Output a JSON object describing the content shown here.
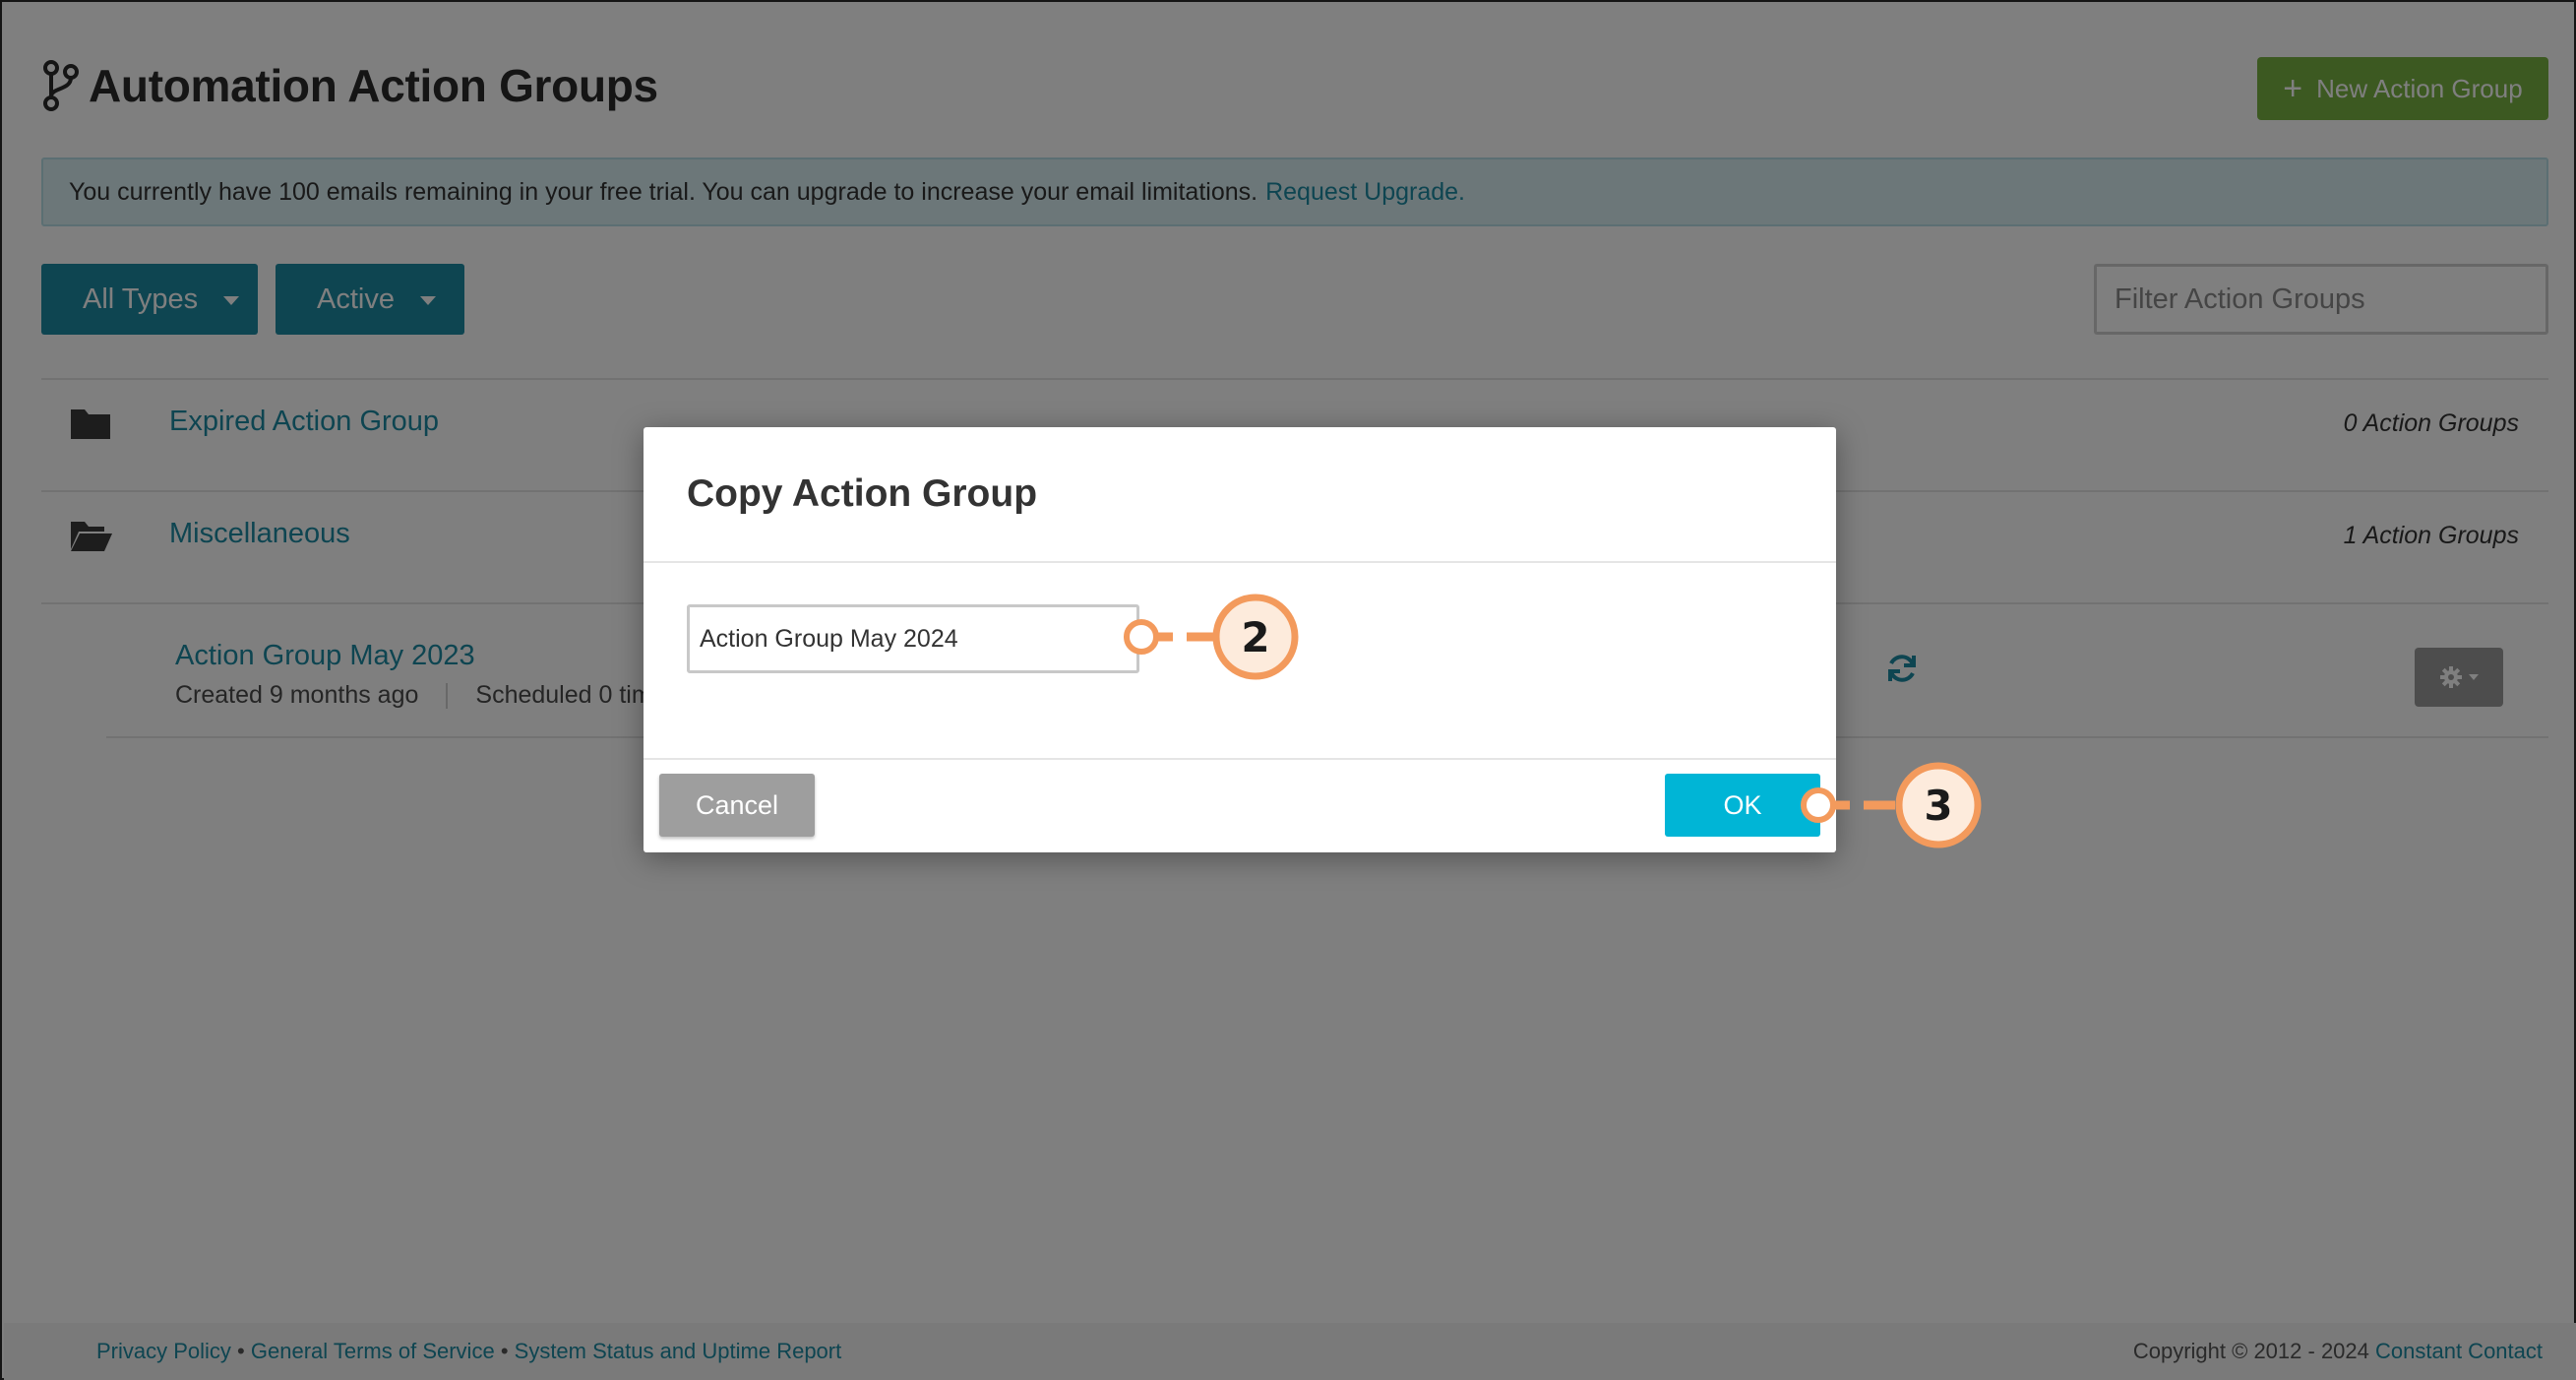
{
  "page": {
    "title": "Automation Action Groups",
    "new_button_label": "New Action Group"
  },
  "alert": {
    "message": "You currently have 100 emails remaining in your free trial. You can upgrade to increase your email limitations.",
    "link_label": "Request Upgrade."
  },
  "filters": {
    "types_label": "All Types",
    "status_label": "Active",
    "search_placeholder": "Filter Action Groups"
  },
  "folders": [
    {
      "name": "Expired Action Group",
      "count": "0 Action Groups",
      "icon": "folder-icon"
    },
    {
      "name": "Miscellaneous",
      "count": "1 Action Groups",
      "icon": "folder-open-icon"
    }
  ],
  "group": {
    "name": "Action Group May 2023",
    "created": "Created 9 months ago",
    "scheduled": "Scheduled 0 tim"
  },
  "modal": {
    "title": "Copy Action Group",
    "input_value": "Action Group May 2024",
    "cancel_label": "Cancel",
    "ok_label": "OK"
  },
  "callouts": {
    "step_input": "2",
    "step_ok": "3",
    "color": "#f39a5c"
  },
  "footer": {
    "privacy": "Privacy Policy",
    "terms": "General Terms of Service",
    "status": "System Status and Uptime Report",
    "separator": "•",
    "copyright": "Copyright © 2012 - 2024",
    "company": "Constant Contact"
  },
  "colors": {
    "accent": "#1c8aa3",
    "new_button": "#78b342",
    "ok_button": "#00b5d6",
    "cancel_button": "#9e9e9e"
  }
}
